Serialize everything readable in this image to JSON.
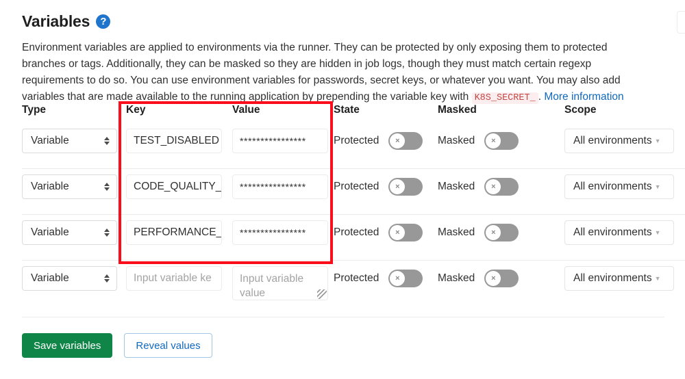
{
  "header": {
    "title": "Variables",
    "help_icon": "question-circle-icon"
  },
  "description": {
    "part1": "Environment variables are applied to environments via the runner. They can be protected by only exposing them to protected branches or tags. Additionally, they can be masked so they are hidden in job logs, though they must match certain regexp requirements to do so. You can use environment variables for passwords, secret keys, or whatever you want. You may also add variables that are made available to the running application by prepending the variable key with ",
    "code": "K8S_SECRET_",
    "part2": ". ",
    "link": "More information"
  },
  "table": {
    "headers": {
      "type": "Type",
      "key": "Key",
      "value": "Value",
      "state": "State",
      "masked": "Masked",
      "scope": "Scope"
    },
    "rows": [
      {
        "type": "Variable",
        "key": "TEST_DISABLED",
        "value": "****************",
        "state_label": "Protected",
        "state_toggle": "off",
        "masked_label": "Masked",
        "masked_toggle": "off",
        "scope": "All environments"
      },
      {
        "type": "Variable",
        "key": "CODE_QUALITY_",
        "value": "****************",
        "state_label": "Protected",
        "state_toggle": "off",
        "masked_label": "Masked",
        "masked_toggle": "off",
        "scope": "All environments"
      },
      {
        "type": "Variable",
        "key": "PERFORMANCE_",
        "value": "****************",
        "state_label": "Protected",
        "state_toggle": "off",
        "masked_label": "Masked",
        "masked_toggle": "off",
        "scope": "All environments"
      },
      {
        "type": "Variable",
        "key": "",
        "key_placeholder": "Input variable ke",
        "value": "",
        "value_placeholder": "Input variable value",
        "state_label": "Protected",
        "state_toggle": "off",
        "masked_label": "Masked",
        "masked_toggle": "off",
        "scope": "All environments"
      }
    ],
    "toggle_glyph": "×"
  },
  "footer": {
    "save_label": "Save variables",
    "reveal_label": "Reveal values"
  },
  "annotation": {
    "color": "#fc0d1b"
  }
}
